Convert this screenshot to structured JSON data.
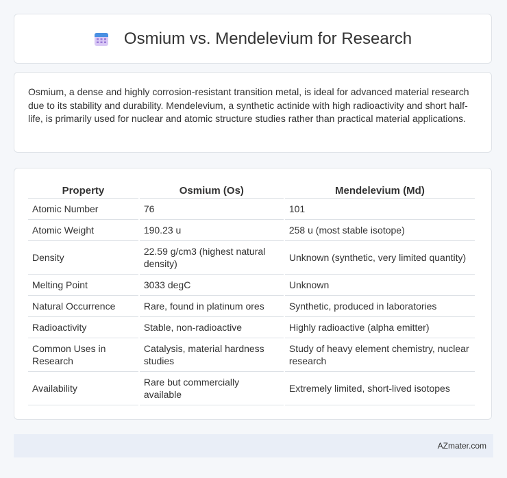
{
  "header": {
    "icon": "calendar-icon",
    "title": "Osmium vs. Mendelevium for Research"
  },
  "intro": {
    "text": "Osmium, a dense and highly corrosion-resistant transition metal, is ideal for advanced material research due to its stability and durability. Mendelevium, a synthetic actinide with high radioactivity and short half-life, is primarily used for nuclear and atomic structure studies rather than practical material applications."
  },
  "table": {
    "headers": [
      "Property",
      "Osmium (Os)",
      "Mendelevium (Md)"
    ],
    "rows": [
      [
        "Atomic Number",
        "76",
        "101"
      ],
      [
        "Atomic Weight",
        "190.23 u",
        "258 u (most stable isotope)"
      ],
      [
        "Density",
        "22.59 g/cm3 (highest natural density)",
        "Unknown (synthetic, very limited quantity)"
      ],
      [
        "Melting Point",
        "3033 degC",
        "Unknown"
      ],
      [
        "Natural Occurrence",
        "Rare, found in platinum ores",
        "Synthetic, produced in laboratories"
      ],
      [
        "Radioactivity",
        "Stable, non-radioactive",
        "Highly radioactive (alpha emitter)"
      ],
      [
        "Common Uses in Research",
        "Catalysis, material hardness studies",
        "Study of heavy element chemistry, nuclear research"
      ],
      [
        "Availability",
        "Rare but commercially available",
        "Extremely limited, short-lived isotopes"
      ]
    ]
  },
  "footer": {
    "brand": "AZmater.com"
  },
  "colors": {
    "page_background": "#f5f7fa",
    "footer_background": "#e9eef7",
    "icon_accent": "#4a90e2",
    "icon_body": "#b89ae8"
  }
}
